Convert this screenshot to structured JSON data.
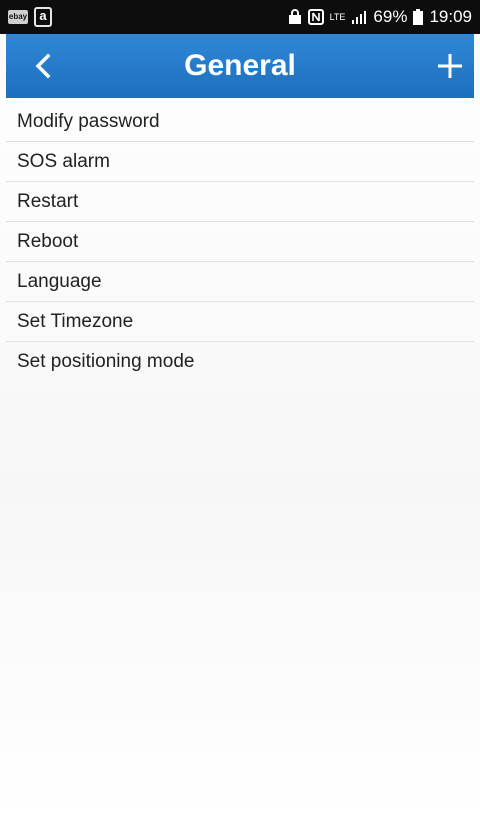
{
  "status_bar": {
    "left_icons": [
      "ebay-icon",
      "amazon-icon"
    ],
    "ebay_glyph": "ebay",
    "amazon_glyph": "a",
    "right_icons": [
      "lock-icon",
      "nfc-icon",
      "lte-icon",
      "signal-icon",
      "battery-icon"
    ],
    "lte_text": "LTE",
    "battery_percent": "69%",
    "time": "19:09"
  },
  "header": {
    "title": "General",
    "back_icon": "chevron-left-icon",
    "add_icon": "plus-icon",
    "accent_color": "#2a80cf"
  },
  "menu": {
    "items": [
      {
        "label": "Modify password"
      },
      {
        "label": "SOS alarm"
      },
      {
        "label": "Restart"
      },
      {
        "label": "Reboot"
      },
      {
        "label": "Language"
      },
      {
        "label": "Set Timezone"
      },
      {
        "label": "Set positioning mode"
      }
    ]
  }
}
